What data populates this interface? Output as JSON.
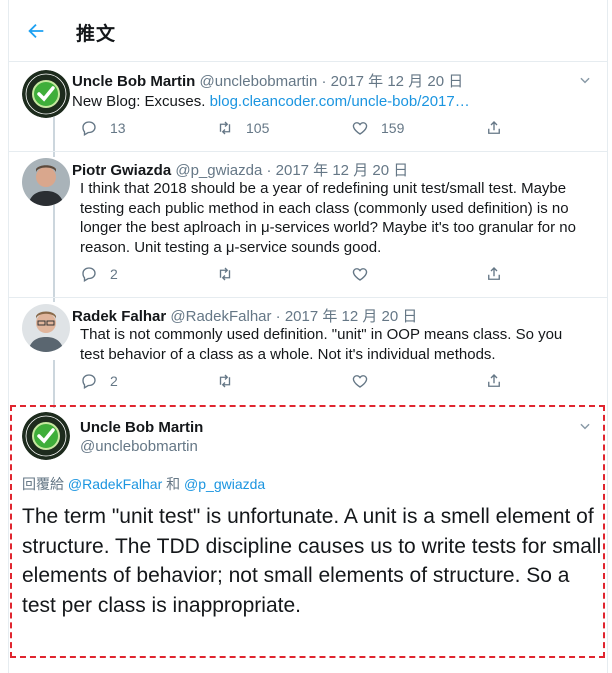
{
  "header": {
    "title": "推文"
  },
  "tweets": [
    {
      "name": "Uncle Bob Martin",
      "meta": "@unclebobmartin · 2017 年 12 月 20 日",
      "text_prefix": "New Blog: Excuses. ",
      "link": "blog.cleancoder.com/uncle-bob/2017…",
      "replies": "13",
      "retweets": "105",
      "likes": "159"
    },
    {
      "name": "Piotr Gwiazda",
      "meta": "@p_gwiazda · 2017 年 12 月 20 日",
      "text": "I think that 2018 should be a year of redefining unit test/small test. Maybe testing each public method in each class (commonly used definition) is no longer the best aplroach in μ-services world? Maybe it's too granular for no reason. Unit testing a μ-service sounds good.",
      "replies": "2"
    },
    {
      "name": "Radek Falhar",
      "meta": "@RadekFalhar · 2017 年 12 月 20 日",
      "text": "That is not commonly used definition. \"unit\" in OOP means class. So you test behavior of a class as a whole. Not it's individual methods.",
      "replies": "2"
    }
  ],
  "focus": {
    "name": "Uncle Bob Martin",
    "handle": "@unclebobmartin",
    "reply_label": "回覆給 ",
    "reply_user1": "@RadekFalhar",
    "reply_and": " 和 ",
    "reply_user2": "@p_gwiazda",
    "text": "The term \"unit test\" is unfortunate.  A unit is a smell element of structure.  The TDD discipline causes us to write tests for small elements of behavior; not small elements of structure.  So a test per class is inappropriate."
  },
  "colors": {
    "accent": "#1da1f2",
    "link": "#1b95e0",
    "muted": "#657786",
    "highlight_border": "#e0252f"
  }
}
